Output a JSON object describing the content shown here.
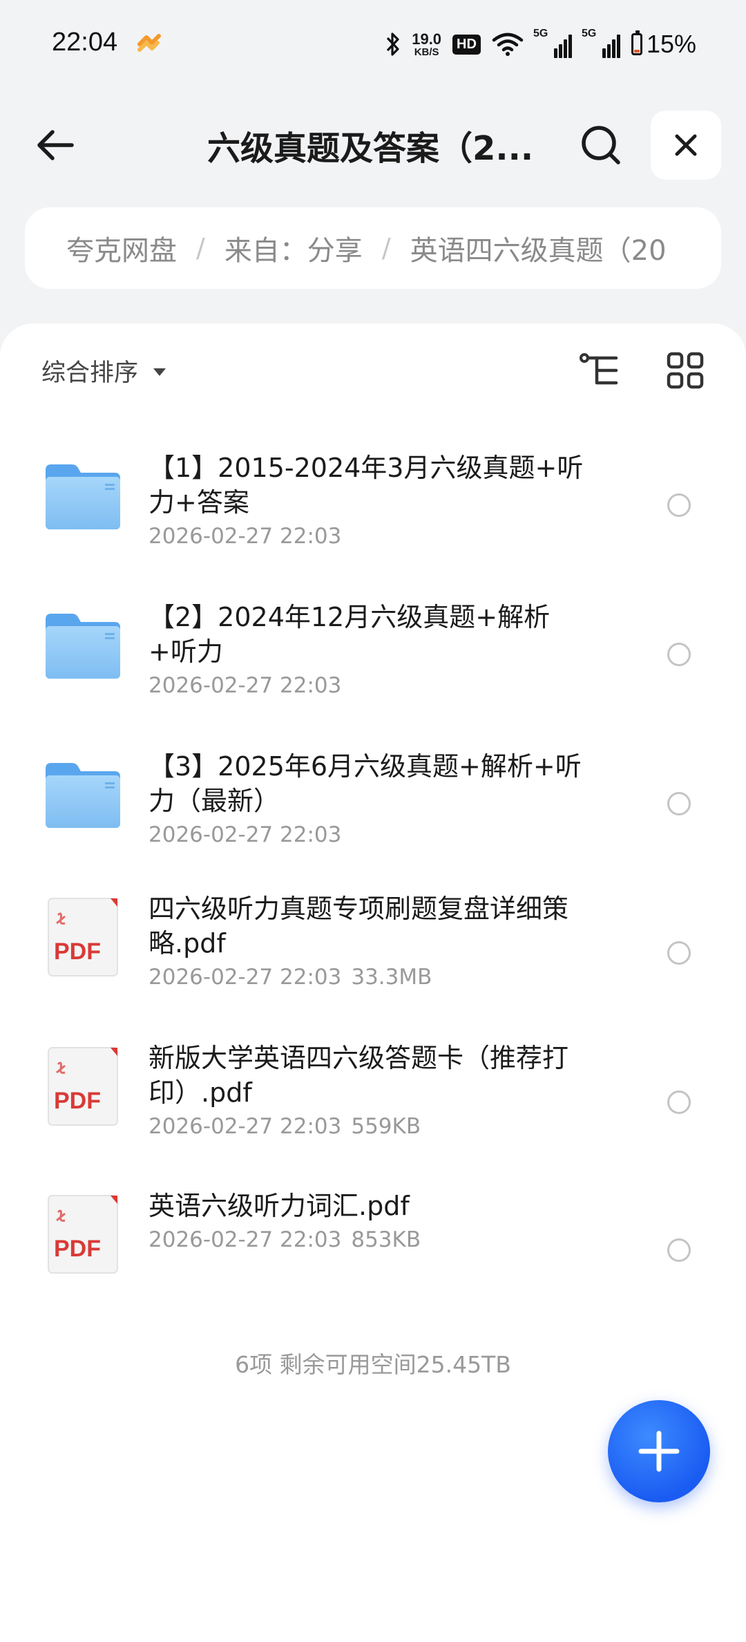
{
  "status_bar": {
    "time": "22:04",
    "net_speed": "19.0",
    "net_unit": "KB/S",
    "hd_label": "HD",
    "signal_1": "5G",
    "signal_2": "5G",
    "battery": "15%",
    "battery_level": 0.15
  },
  "header": {
    "title": "六级真题及答案（2..."
  },
  "breadcrumb": {
    "items": [
      "夸克网盘",
      "来自：分享",
      "英语四六级真题（20"
    ],
    "separator": "/"
  },
  "toolbar": {
    "sort_label": "综合排序"
  },
  "files": [
    {
      "name": "【1】2015-2024年3月六级真题+听力+答案",
      "date": "2026-02-27 22:03",
      "size": "",
      "type": "folder"
    },
    {
      "name": "【2】2024年12月六级真题+解析+听力",
      "date": "2026-02-27 22:03",
      "size": "",
      "type": "folder"
    },
    {
      "name": "【3】2025年6月六级真题+解析+听力（最新）",
      "date": "2026-02-27 22:03",
      "size": "",
      "type": "folder"
    },
    {
      "name": "四六级听力真题专项刷题复盘详细策略.pdf",
      "date": "2026-02-27 22:03",
      "size": "33.3MB",
      "type": "pdf"
    },
    {
      "name": "新版大学英语四六级答题卡（推荐打印）.pdf",
      "date": "2026-02-27 22:03",
      "size": "559KB",
      "type": "pdf"
    },
    {
      "name": "英语六级听力词汇.pdf",
      "date": "2026-02-27 22:03",
      "size": "853KB",
      "type": "pdf"
    }
  ],
  "pdf_badge": "PDF",
  "footer": {
    "summary": "6项 剩余可用空间25.45TB"
  },
  "colors": {
    "accent": "#1a5cf2",
    "folder": "#8cc8f6",
    "pdf_red": "#d93a36",
    "muted": "#999999"
  },
  "icons": {
    "back": "arrow-left-icon",
    "search": "search-icon",
    "close": "close-icon",
    "tree": "tree-view-icon",
    "grid": "grid-view-icon",
    "folder": "folder-icon",
    "pdf": "pdf-file-icon",
    "add": "plus-icon"
  }
}
